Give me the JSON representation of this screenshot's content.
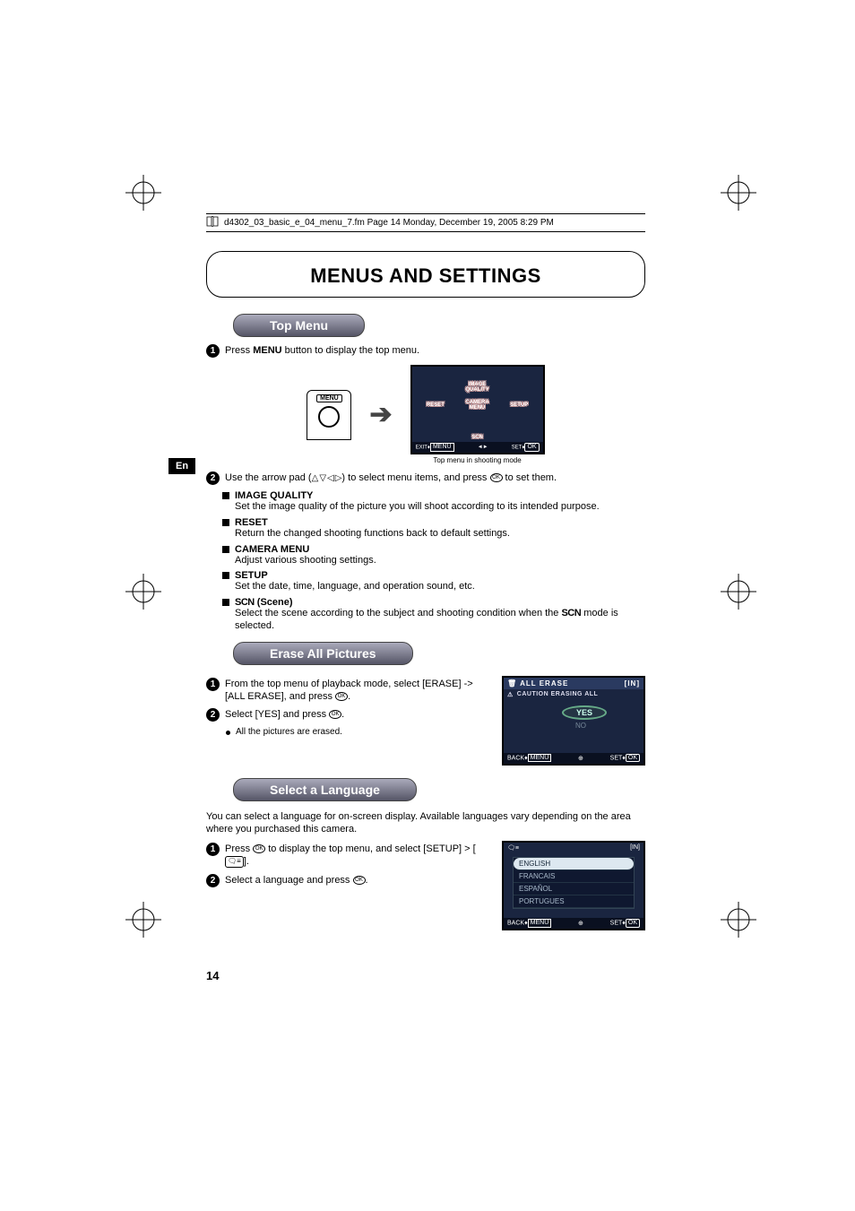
{
  "header_line": "d4302_03_basic_e_04_menu_7.fm  Page 14  Monday, December 19, 2005  8:29 PM",
  "en_tab": "En",
  "page_title": "MENUS AND SETTINGS",
  "sections": {
    "top_menu": {
      "pill": "Top Menu",
      "step1": {
        "pre": "Press ",
        "bold": "MENU",
        "post": " button to display the top menu."
      },
      "menu_btn_label": "MENU",
      "lcd": {
        "items": [
          "IMAGE QUALITY",
          "RESET",
          "CAMERA MENU",
          "SETUP",
          "SCN"
        ],
        "footer_left": "EXIT",
        "footer_mid": "",
        "footer_right": "SET",
        "caption": "Top menu in shooting mode"
      },
      "step2": {
        "pre": "Use the arrow pad (",
        "post": ") to select menu items, and press ",
        "tail": " to set them."
      },
      "bullets": [
        {
          "head": "IMAGE QUALITY",
          "desc": "Set the image quality of the picture you will shoot according to its intended purpose."
        },
        {
          "head": "RESET",
          "desc": "Return the changed shooting functions back to default settings."
        },
        {
          "head": "CAMERA MENU",
          "desc": "Adjust various shooting settings."
        },
        {
          "head": "SETUP",
          "desc": "Set the date, time, language, and operation sound, etc."
        }
      ],
      "scn_bullet": {
        "head_scn": "SCN",
        "head_paren": " (Scene)",
        "desc_pre": "Select the scene according to the subject and shooting condition when the ",
        "desc_scn": "SCN",
        "desc_post": " mode is selected."
      }
    },
    "erase": {
      "pill": "Erase All Pictures",
      "step1": "From the top menu of playback mode, select [ERASE] -> [ALL ERASE], and press ",
      "step1_tail": ".",
      "step2": "Select [YES] and press ",
      "step2_tail": ".",
      "sub": "All the pictures are erased.",
      "lcd": {
        "title": "ALL ERASE",
        "in": "[IN]",
        "msg": "CAUTION ERASING ALL",
        "yes": "YES",
        "no": "NO",
        "back": "BACK",
        "set": "SET"
      }
    },
    "language": {
      "pill": "Select a Language",
      "intro": "You can select a language for on-screen display. Available languages vary depending on the area where you purchased this camera.",
      "step1_pre": "Press ",
      "step1_mid": " to display the top menu, and select [SETUP] > [",
      "step1_post": "].",
      "step2": "Select a language and press ",
      "step2_tail": ".",
      "lcd": {
        "in": "[IN]",
        "options": [
          "ENGLISH",
          "FRANCAIS",
          "ESPAÑOL",
          "PORTUGUES"
        ],
        "back": "BACK",
        "set": "SET"
      }
    }
  },
  "page_number": "14",
  "icons": {
    "ok_label": "OK",
    "menu_label": "MENU"
  }
}
